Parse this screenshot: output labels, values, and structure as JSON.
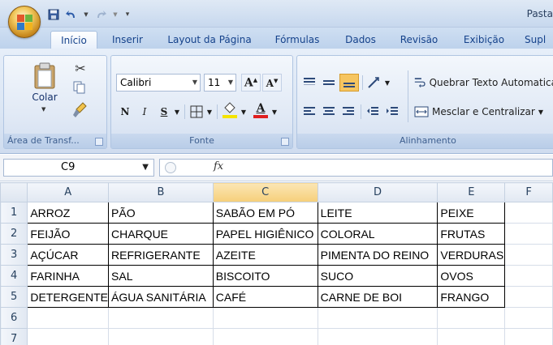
{
  "window": {
    "title": "Pasta"
  },
  "tabs": [
    {
      "label": "Início",
      "active": true
    },
    {
      "label": "Inserir"
    },
    {
      "label": "Layout da Página"
    },
    {
      "label": "Fórmulas"
    },
    {
      "label": "Dados"
    },
    {
      "label": "Revisão"
    },
    {
      "label": "Exibição"
    },
    {
      "label": "Supl"
    }
  ],
  "ribbon": {
    "clipboard": {
      "paste_label": "Colar",
      "caption": "Área de Transf..."
    },
    "font": {
      "font_name": "Calibri",
      "font_size": "11",
      "bold": "N",
      "italic": "I",
      "underline": "S",
      "font_color_letter": "A",
      "caption": "Fonte",
      "highlight_color": "#f5e400",
      "font_color": "#e02020"
    },
    "alignment": {
      "wrap_text": "Quebrar Texto Automatica",
      "merge_center": "Mesclar e Centralizar",
      "caption": "Alinhamento"
    }
  },
  "formula_bar": {
    "name_box": "C9",
    "fx": "fx",
    "content": ""
  },
  "sheet": {
    "columns": [
      "A",
      "B",
      "C",
      "D",
      "E",
      "F"
    ],
    "selected_column": "C",
    "rows": [
      {
        "num": "1",
        "cells": [
          "ARROZ",
          "PÃO",
          "SABÃO EM PÓ",
          "LEITE",
          "PEIXE",
          ""
        ]
      },
      {
        "num": "2",
        "cells": [
          "FEIJÃO",
          "CHARQUE",
          "PAPEL HIGIÊNICO",
          "COLORAL",
          "FRUTAS",
          ""
        ]
      },
      {
        "num": "3",
        "cells": [
          "AÇÚCAR",
          "REFRIGERANTE",
          "AZEITE",
          "PIMENTA DO REINO",
          "VERDURAS",
          ""
        ]
      },
      {
        "num": "4",
        "cells": [
          "FARINHA",
          "SAL",
          "BISCOITO",
          "SUCO",
          "OVOS",
          ""
        ]
      },
      {
        "num": "5",
        "cells": [
          "DETERGENTE",
          "ÁGUA SANITÁRIA",
          "CAFÉ",
          "CARNE DE BOI",
          "FRANGO",
          ""
        ]
      },
      {
        "num": "6",
        "cells": [
          "",
          "",
          "",
          "",
          "",
          ""
        ]
      },
      {
        "num": "7",
        "cells": [
          "",
          "",
          "",
          "",
          "",
          ""
        ]
      }
    ]
  }
}
